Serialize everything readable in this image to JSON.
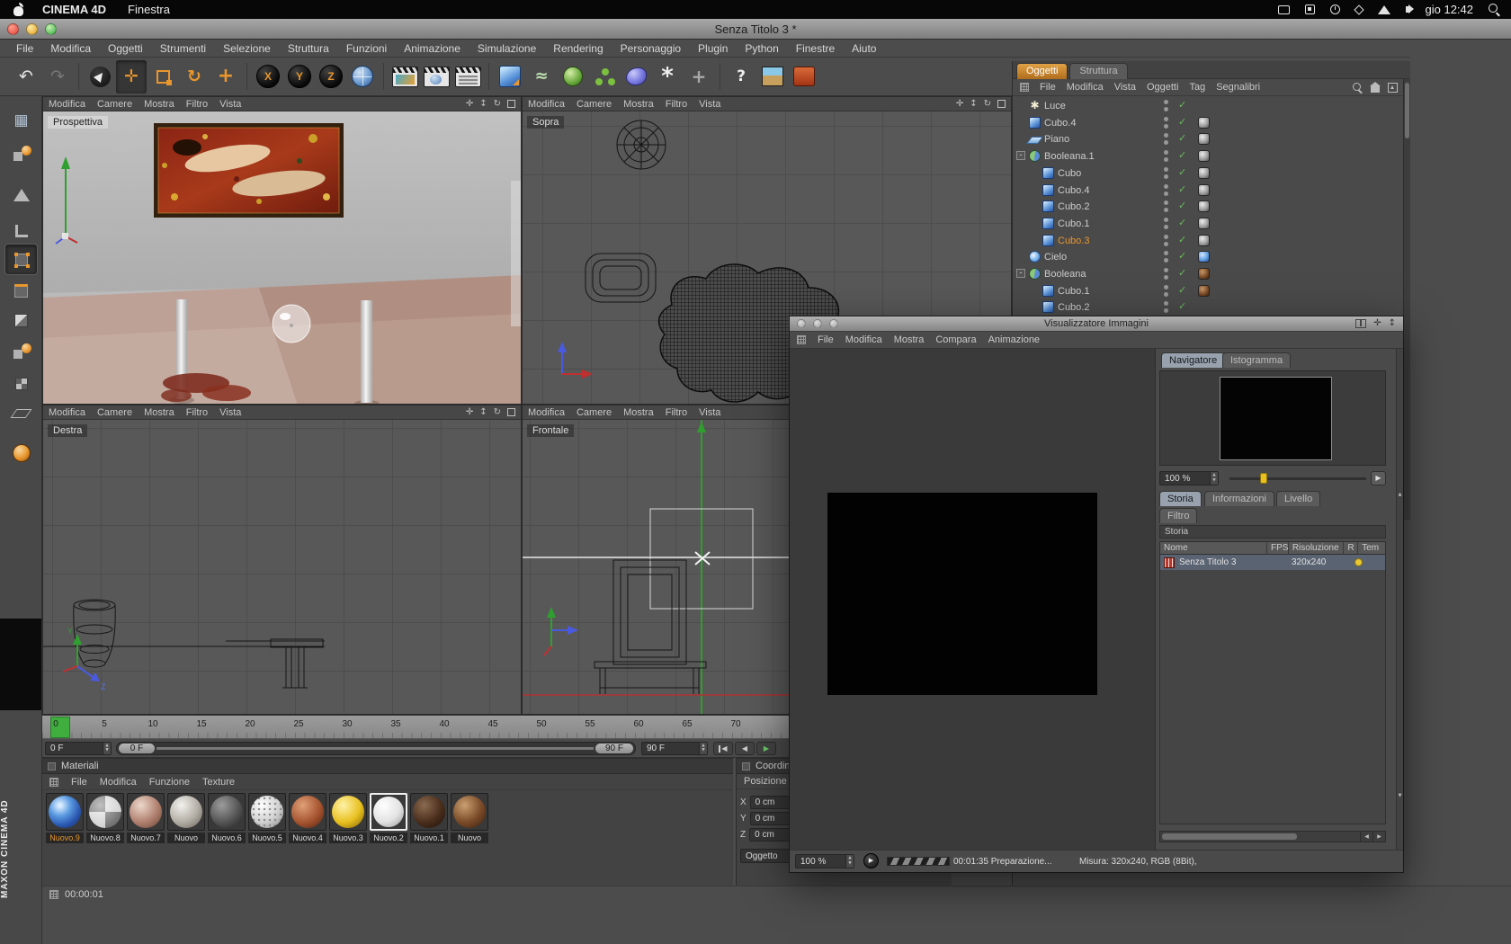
{
  "colors": {
    "accent_orange": "#e8962d",
    "playhead_green": "#3fae3f",
    "axis_green": "#2f9e2f",
    "axis_red": "#c03030",
    "axis_blue": "#4a5ae0"
  },
  "os": {
    "app_name": "CINEMA 4D",
    "menu_item": "Finestra",
    "clock": "gio 12:42"
  },
  "window": {
    "title": "Senza Titolo 3 *"
  },
  "menu": {
    "items": [
      "File",
      "Modifica",
      "Oggetti",
      "Strumenti",
      "Selezione",
      "Struttura",
      "Funzioni",
      "Animazione",
      "Simulazione",
      "Rendering",
      "Personaggio",
      "Plugin",
      "Python",
      "Finestre",
      "Aiuto"
    ]
  },
  "viewport_menu": {
    "items": [
      "Modifica",
      "Camere",
      "Mostra",
      "Filtro",
      "Vista"
    ]
  },
  "viewports": {
    "perspective": "Prospettiva",
    "top": "Sopra",
    "right": "Destra",
    "front": "Frontale"
  },
  "axis_labels": {
    "x": "X",
    "y": "Y",
    "z": "Z"
  },
  "object_manager": {
    "tabs": [
      "Oggetti",
      "Struttura"
    ],
    "menu": [
      "File",
      "Modifica",
      "Vista",
      "Oggetti",
      "Tag",
      "Segnalibri"
    ],
    "items": [
      {
        "name": "Luce"
      },
      {
        "name": "Cubo.4"
      },
      {
        "name": "Piano"
      },
      {
        "name": "Booleana.1"
      },
      {
        "name": "Cubo"
      },
      {
        "name": "Cubo.4"
      },
      {
        "name": "Cubo.2"
      },
      {
        "name": "Cubo.1"
      },
      {
        "name": "Cubo.3"
      },
      {
        "name": "Cielo"
      },
      {
        "name": "Booleana"
      },
      {
        "name": "Cubo.1"
      },
      {
        "name": "Cubo.2"
      }
    ]
  },
  "picture_viewer": {
    "title": "Visualizzatore Immagini",
    "menu": [
      "File",
      "Modifica",
      "Mostra",
      "Compara",
      "Animazione"
    ],
    "nav_tabs": [
      "Navigatore",
      "Istogramma"
    ],
    "zoom_value": "100 %",
    "info_tabs": [
      "Storia",
      "Informazioni",
      "Livello",
      "Filtro"
    ],
    "section_title": "Storia",
    "table_headers": [
      "Nome",
      "FPS",
      "Risoluzione",
      "R",
      "Tem"
    ],
    "history": {
      "name": "Senza Titolo 3",
      "resolution": "320x240"
    },
    "bottom_zoom": "100 %",
    "progress_text": "00:01:35 Preparazione...",
    "measure_text": "Misura: 320x240, RGB (8Bit),"
  },
  "timeline": {
    "ticks": [
      "0",
      "5",
      "10",
      "15",
      "20",
      "25",
      "30",
      "35",
      "40",
      "45",
      "50",
      "55",
      "60",
      "65",
      "70"
    ]
  },
  "transport": {
    "current_frame": "0 F",
    "range_start": "0 F",
    "range_end": "90 F",
    "end_frame": "90 F"
  },
  "materials": {
    "title": "Materiali",
    "menu": [
      "File",
      "Modifica",
      "Funzione",
      "Texture"
    ],
    "items": [
      {
        "label": "Nuovo.9"
      },
      {
        "label": "Nuovo.8"
      },
      {
        "label": "Nuovo.7"
      },
      {
        "label": "Nuovo"
      },
      {
        "label": "Nuovo.6"
      },
      {
        "label": "Nuovo.5"
      },
      {
        "label": "Nuovo.4"
      },
      {
        "label": "Nuovo.3"
      },
      {
        "label": "Nuovo.2"
      },
      {
        "label": "Nuovo.1"
      },
      {
        "label": "Nuovo"
      }
    ]
  },
  "coordinates": {
    "title": "Coordinate",
    "section": "Posizione",
    "fields": [
      {
        "label": "X",
        "value": "0 cm"
      },
      {
        "label": "Y",
        "value": "0 cm"
      },
      {
        "label": "Z",
        "value": "0 cm"
      }
    ],
    "system": "Oggetto"
  },
  "status": {
    "time": "00:00:01"
  },
  "branding": {
    "vertical": "MAXON CINEMA 4D"
  }
}
